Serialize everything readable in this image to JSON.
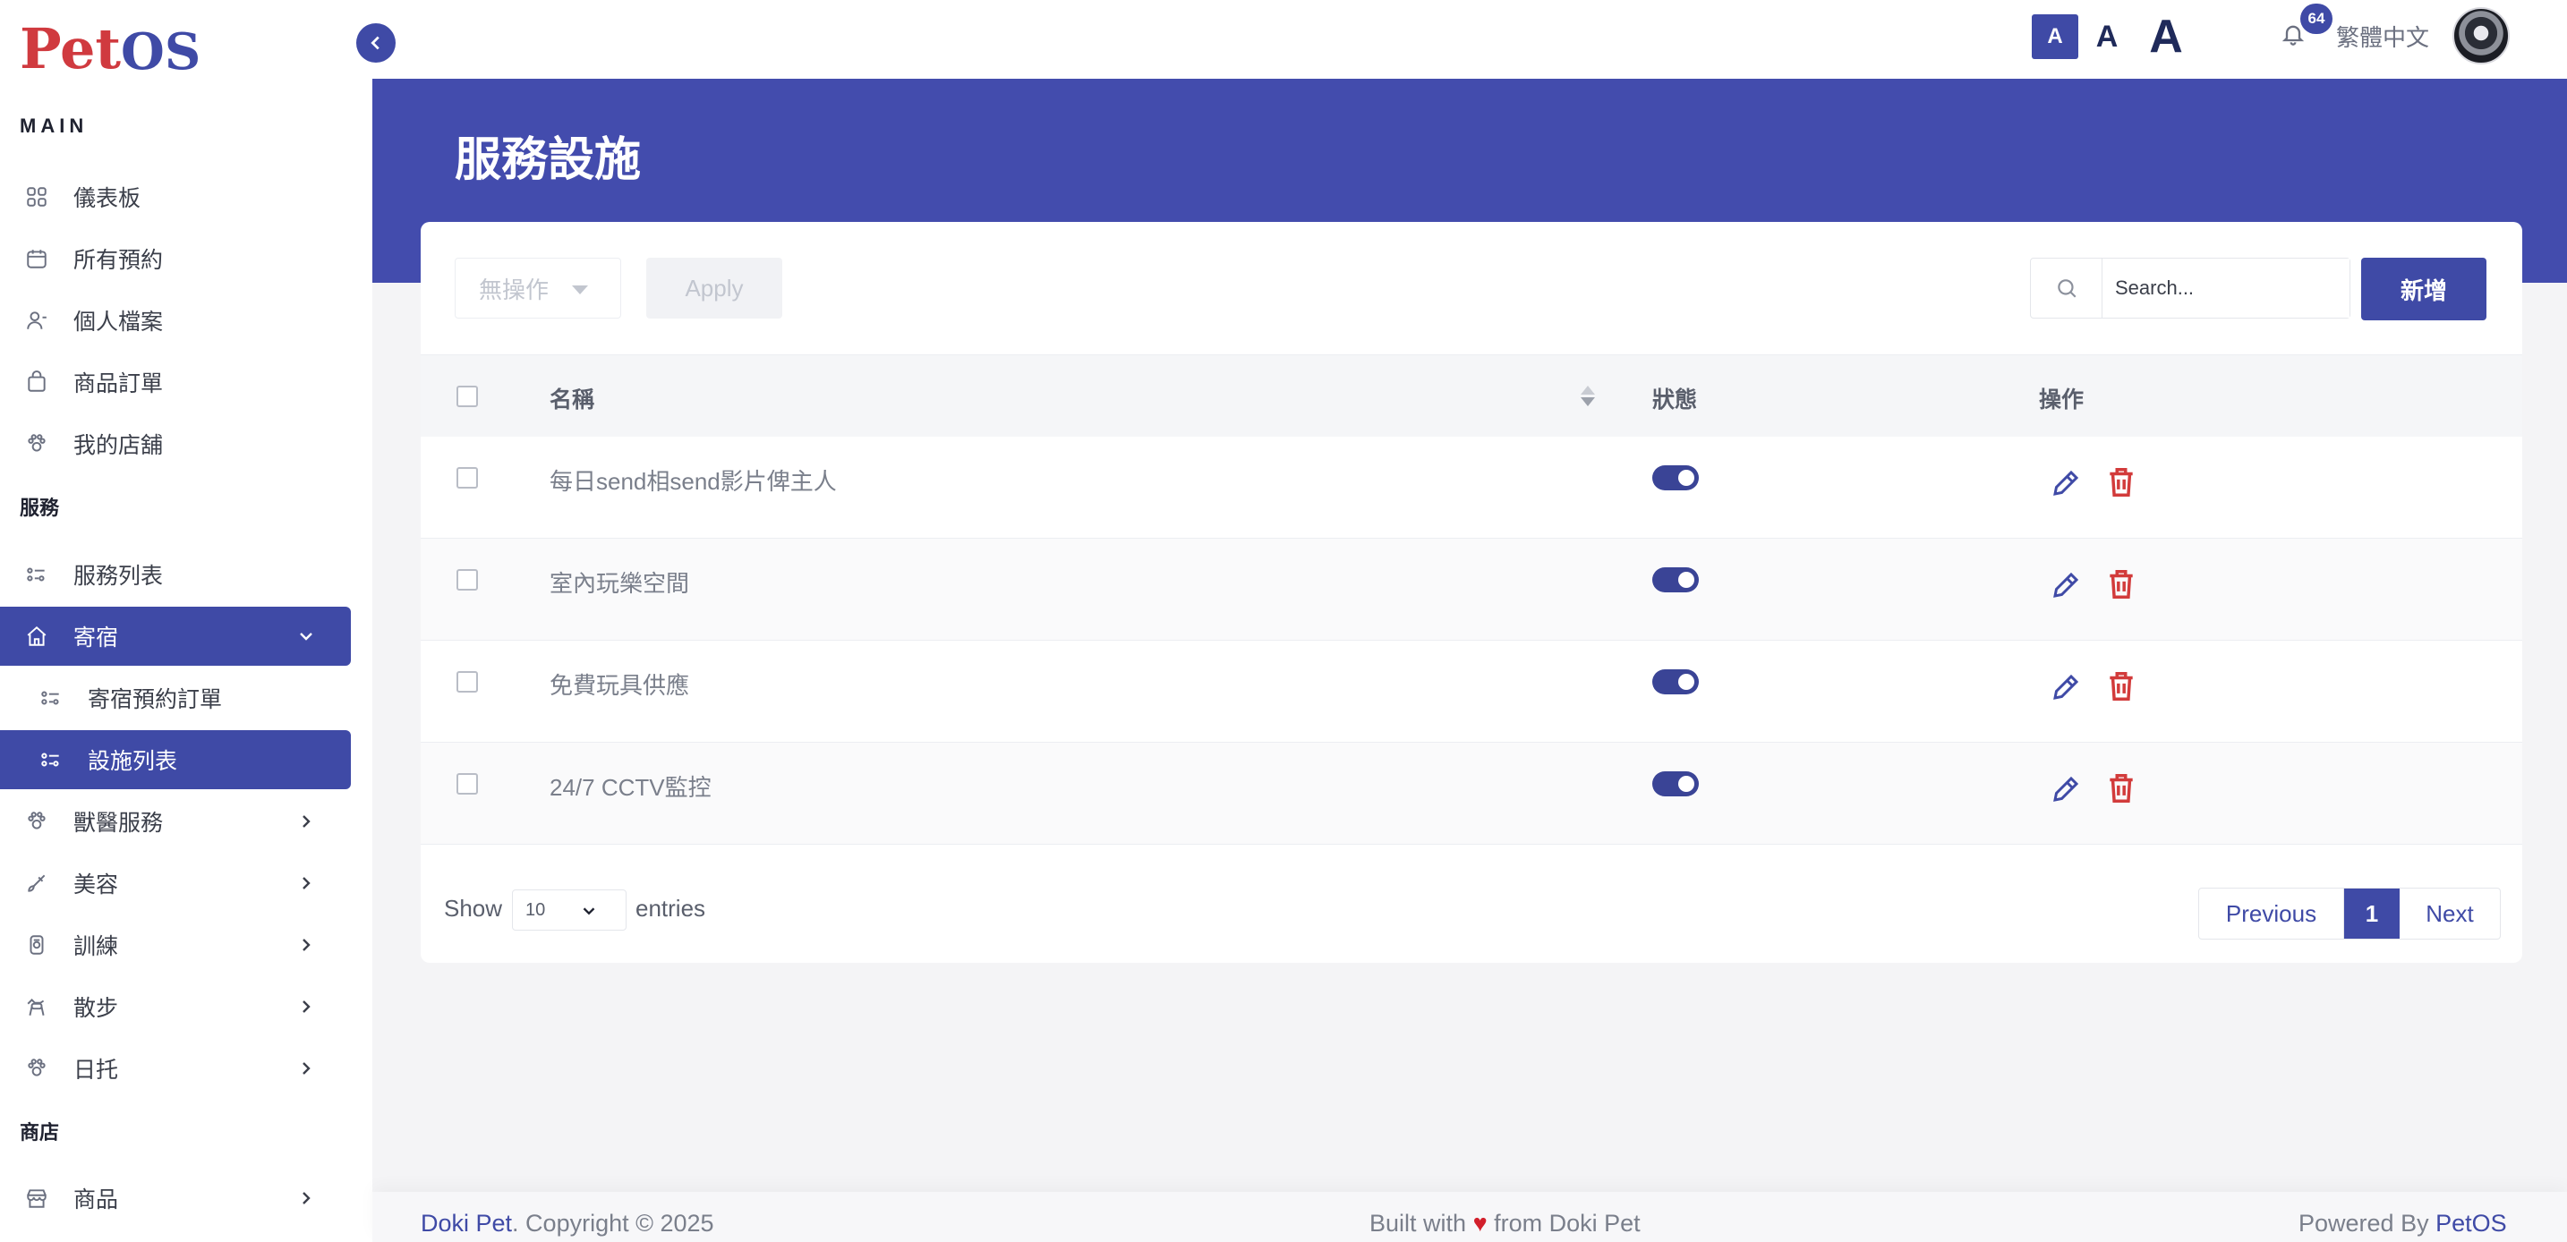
{
  "sidebar": {
    "logo_part1": "Pet",
    "logo_part2": "OS",
    "section_main": "MAIN",
    "section_services": "服務",
    "section_shop": "商店",
    "items": [
      {
        "label": "儀表板",
        "icon": "grid-icon"
      },
      {
        "label": "所有預約",
        "icon": "calendar-icon"
      },
      {
        "label": "個人檔案",
        "icon": "user-icon"
      },
      {
        "label": "商品訂單",
        "icon": "shopping-bag-icon"
      },
      {
        "label": "我的店舖",
        "icon": "paw-icon"
      },
      {
        "label": "服務列表",
        "icon": "list-icon"
      },
      {
        "label": "寄宿",
        "icon": "home-icon"
      },
      {
        "label": "寄宿預約訂單",
        "icon": "list-icon"
      },
      {
        "label": "設施列表",
        "icon": "list-icon"
      },
      {
        "label": "獸醫服務",
        "icon": "paw-icon"
      },
      {
        "label": "美容",
        "icon": "brush-icon"
      },
      {
        "label": "訓練",
        "icon": "medal-icon"
      },
      {
        "label": "散步",
        "icon": "dog-walk-icon"
      },
      {
        "label": "日托",
        "icon": "paw-icon"
      },
      {
        "label": "商品",
        "icon": "store-icon"
      }
    ]
  },
  "topbar": {
    "font_small": "A",
    "font_mid": "A",
    "font_large": "A",
    "notification_count": "64",
    "language": "繁體中文"
  },
  "page": {
    "title": "服務設施"
  },
  "toolbar": {
    "bulk_action": "無操作",
    "apply_label": "Apply",
    "search_placeholder": "Search...",
    "add_label": "新增"
  },
  "table": {
    "headers": {
      "name": "名稱",
      "status": "狀態",
      "actions": "操作"
    },
    "rows": [
      {
        "name": "每日send相send影片俾主人",
        "enabled": true
      },
      {
        "name": "室內玩樂空間",
        "enabled": true
      },
      {
        "name": "免費玩具供應",
        "enabled": true
      },
      {
        "name": "24/7 CCTV監控",
        "enabled": true
      }
    ]
  },
  "pagination": {
    "show_label": "Show",
    "page_size": "10",
    "entries_label": "entries",
    "previous_label": "Previous",
    "current_page": "1",
    "next_label": "Next"
  },
  "footer": {
    "brand_left": "Doki Pet",
    "copyright": ". Copyright © 2025",
    "built_with": "Built with",
    "heart": "♥",
    "from": "from Doki Pet",
    "powered_by": "Powered By",
    "brand_right": "PetOS"
  },
  "colors": {
    "primary": "#3f4aa6",
    "banner": "#434cad",
    "danger": "#d23b3b",
    "logo_red": "#d03a3f"
  }
}
